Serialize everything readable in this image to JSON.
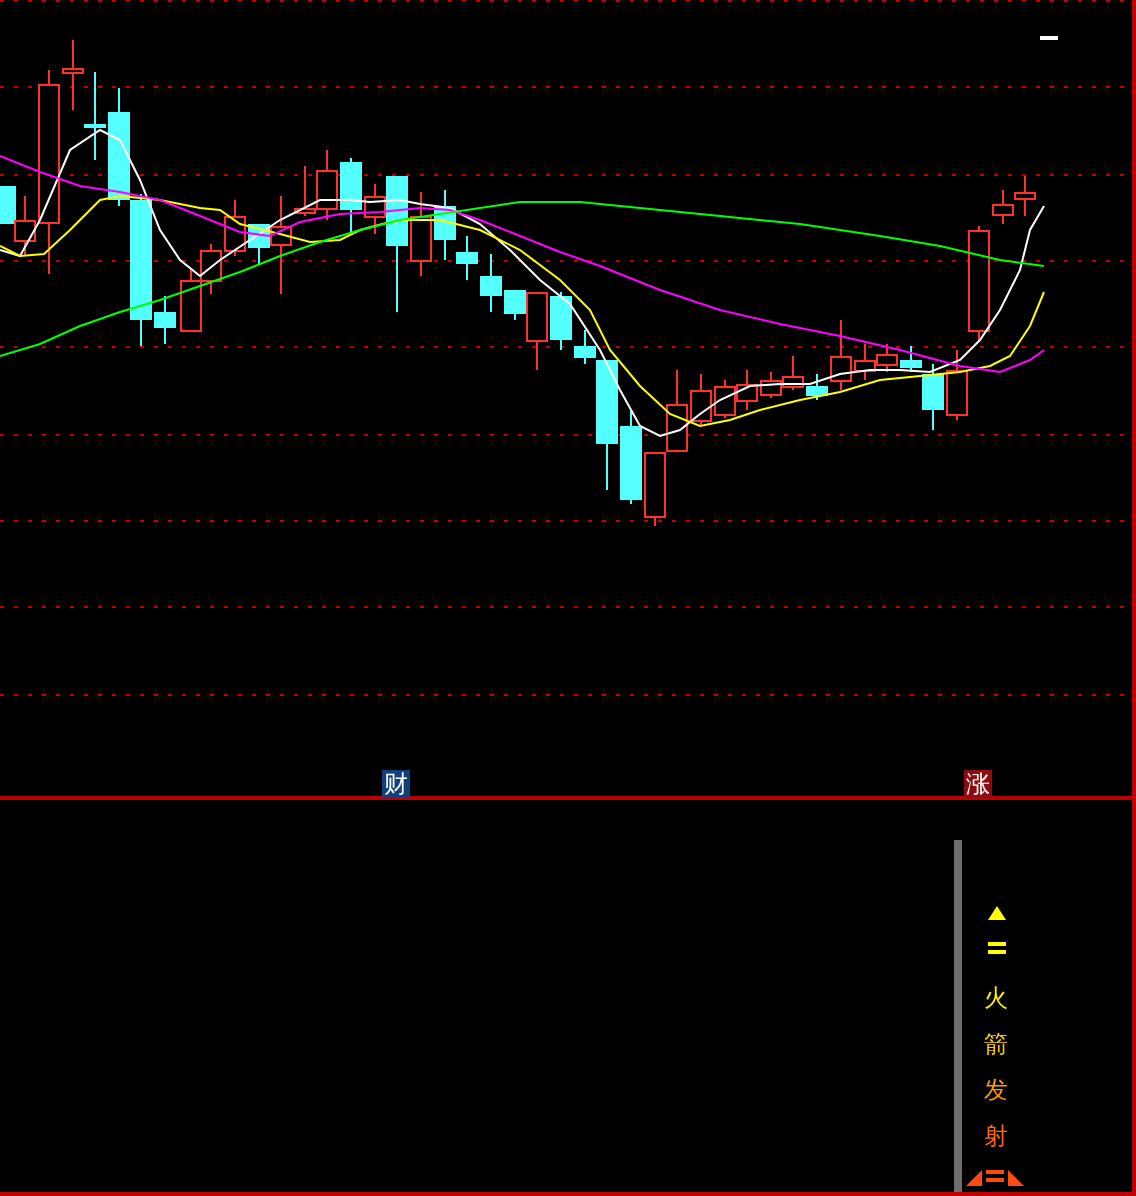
{
  "main_chart": {
    "markers": [
      {
        "label": "财",
        "color": "#12407a"
      },
      {
        "label": "涨",
        "color": "#8c0c12"
      }
    ]
  },
  "indicator_panel": {
    "signal_labels": [
      {
        "text": "火",
        "color": "#ffee00"
      },
      {
        "text": "箭",
        "color": "#ffcc00"
      },
      {
        "text": "发",
        "color": "#ff9a00"
      },
      {
        "text": "射",
        "color": "#ff6a10"
      }
    ]
  }
}
